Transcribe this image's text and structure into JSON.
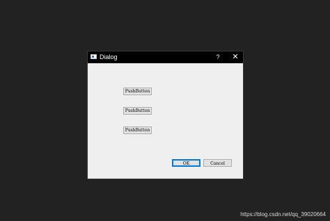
{
  "dialog": {
    "title": "Dialog",
    "help_label": "?",
    "close_label": "✕",
    "buttons": [
      "PushButton",
      "PushButton",
      "PushButton"
    ],
    "ok_label": "OK",
    "cancel_label": "Cancel"
  },
  "watermark": "https://blog.csdn.net/qq_39020664",
  "colors": {
    "desktop": "#222222",
    "titlebar": "#000000",
    "dialog_body": "#efefef",
    "focus_border": "#0078d7"
  },
  "icons": {
    "window": "window-icon",
    "help": "help-icon",
    "close": "close-icon"
  }
}
